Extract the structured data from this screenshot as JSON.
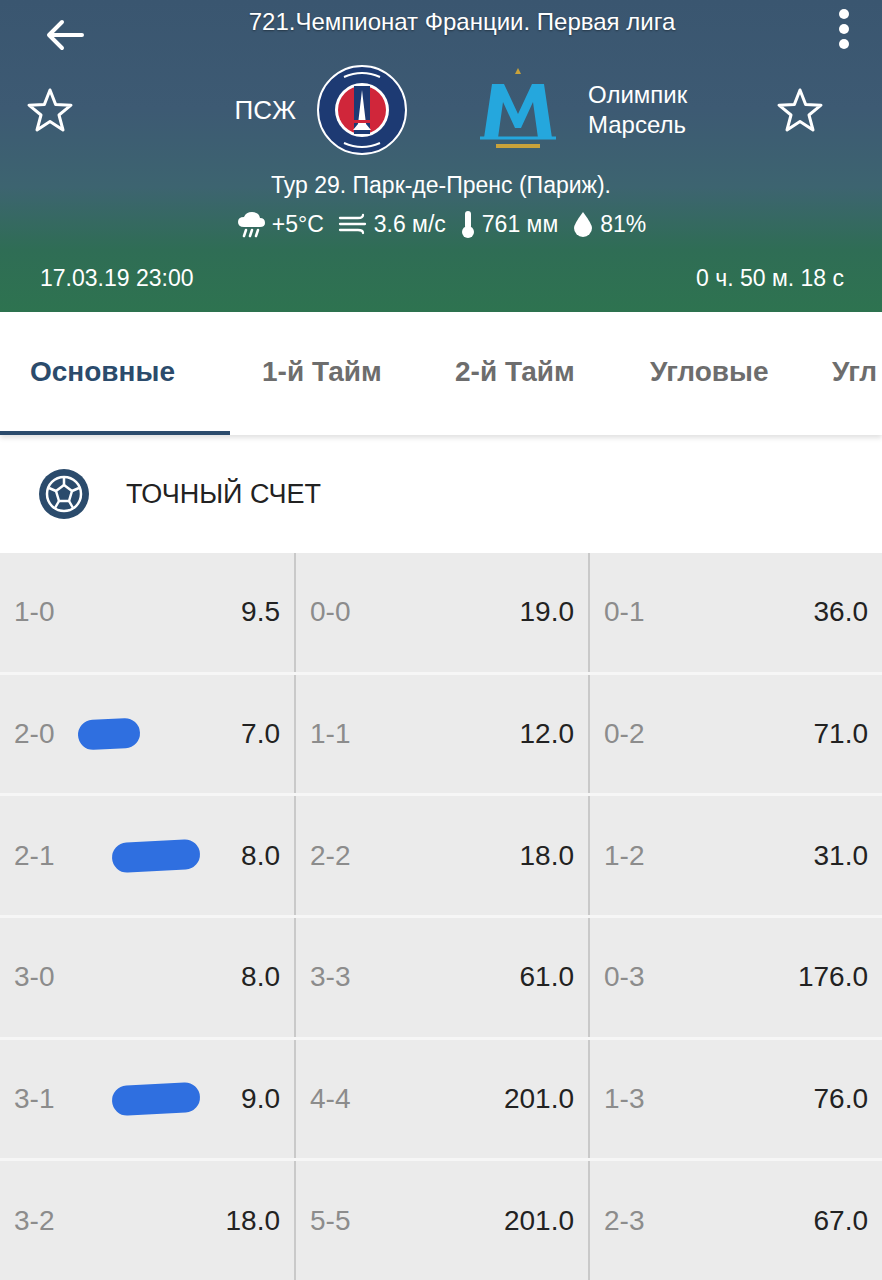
{
  "header": {
    "title": "721.Чемпионат Франции. Первая лига",
    "home_team": {
      "name": "ПСЖ",
      "favorite": false
    },
    "away_team": {
      "name": "Олимпик Марсель",
      "favorite": false
    },
    "venue": "Тур 29. Парк-де-Пренс (Париж).",
    "weather": [
      {
        "kind": "precipitation",
        "value": "+5°C"
      },
      {
        "kind": "wind",
        "value": "3.6 м/с"
      },
      {
        "kind": "pressure",
        "value": "761 мм"
      },
      {
        "kind": "humidity",
        "value": "81%"
      }
    ],
    "datetime": "17.03.19 23:00",
    "countdown": "0 ч. 50 м. 18 с"
  },
  "tabs": [
    {
      "label": "Основные",
      "selected": true
    },
    {
      "label": "1-й Тайм",
      "selected": false
    },
    {
      "label": "2-й Тайм",
      "selected": false
    },
    {
      "label": "Угловые",
      "selected": false
    },
    {
      "label": "Угл",
      "selected": false
    }
  ],
  "market": {
    "title": "ТОЧНЫЙ СЧЕТ",
    "rows": [
      [
        {
          "score": "1-0",
          "odds": "9.5",
          "marked": false
        },
        {
          "score": "0-0",
          "odds": "19.0",
          "marked": false
        },
        {
          "score": "0-1",
          "odds": "36.0",
          "marked": false
        }
      ],
      [
        {
          "score": "2-0",
          "odds": "7.0",
          "marked": true
        },
        {
          "score": "1-1",
          "odds": "12.0",
          "marked": false
        },
        {
          "score": "0-2",
          "odds": "71.0",
          "marked": false
        }
      ],
      [
        {
          "score": "2-1",
          "odds": "8.0",
          "marked": true
        },
        {
          "score": "2-2",
          "odds": "18.0",
          "marked": false
        },
        {
          "score": "1-2",
          "odds": "31.0",
          "marked": false
        }
      ],
      [
        {
          "score": "3-0",
          "odds": "8.0",
          "marked": false
        },
        {
          "score": "3-3",
          "odds": "61.0",
          "marked": false
        },
        {
          "score": "0-3",
          "odds": "176.0",
          "marked": false
        }
      ],
      [
        {
          "score": "3-1",
          "odds": "9.0",
          "marked": true
        },
        {
          "score": "4-4",
          "odds": "201.0",
          "marked": false
        },
        {
          "score": "1-3",
          "odds": "76.0",
          "marked": false
        }
      ],
      [
        {
          "score": "3-2",
          "odds": "18.0",
          "marked": false
        },
        {
          "score": "5-5",
          "odds": "201.0",
          "marked": false
        },
        {
          "score": "2-3",
          "odds": "67.0",
          "marked": false
        }
      ]
    ]
  }
}
